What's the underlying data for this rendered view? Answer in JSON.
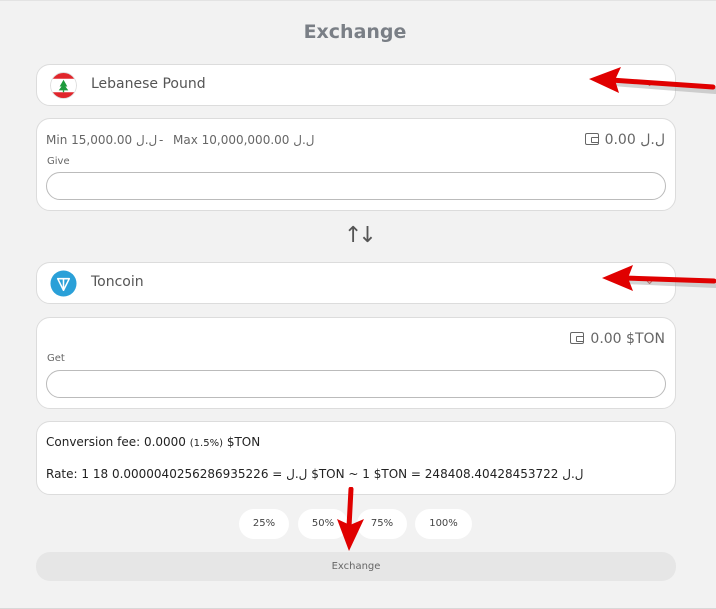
{
  "page": {
    "title": "Exchange"
  },
  "from": {
    "currency": "Lebanese Pound",
    "flag_icon": "lebanon-flag-icon",
    "min": "Min 15,000.00 ل.ل",
    "separator": "-",
    "max": "Max 10,000,000.00 ل.ل",
    "balance": "0.00 ل.ل",
    "field_label": "Give",
    "value": ""
  },
  "to": {
    "currency": "Toncoin",
    "coin_icon": "toncoin-icon",
    "balance": "0.00 $TON",
    "field_label": "Get",
    "value": ""
  },
  "info": {
    "fee_prefix": "Conversion fee: 0.0000",
    "fee_pct": "(1.5%)",
    "fee_suffix": "$TON",
    "rate": "Rate: 1 ل.ل = 0.0000040256286935226 18 $TON ~ 1 $TON = 248408.40428453722 ل.ل"
  },
  "percent_buttons": [
    "25%",
    "50%",
    "75%",
    "100%"
  ],
  "exchange_button": "Exchange",
  "colors": {
    "background": "#f2f2f2",
    "card": "#ffffff",
    "annotation_arrow": "#e00000"
  }
}
